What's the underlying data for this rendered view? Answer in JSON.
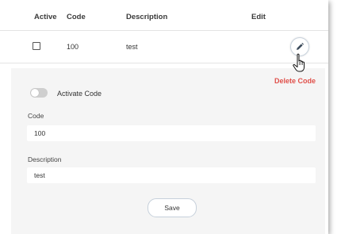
{
  "table": {
    "headers": {
      "active": "Active",
      "code": "Code",
      "description": "Description",
      "edit": "Edit"
    },
    "rows": [
      {
        "active": false,
        "code": "100",
        "description": "test"
      }
    ]
  },
  "form": {
    "delete_label": "Delete Code",
    "toggle_label": "Activate Code",
    "toggle_on": false,
    "code_label": "Code",
    "code_value": "100",
    "description_label": "Description",
    "description_value": "test",
    "save_label": "Save"
  },
  "icons": {
    "edit": "pencil-icon",
    "cursor": "hand-pointer-icon"
  },
  "colors": {
    "delete": "#e0504a",
    "form_bg": "#f5f5f5",
    "edit_border": "#c9d3dd"
  }
}
